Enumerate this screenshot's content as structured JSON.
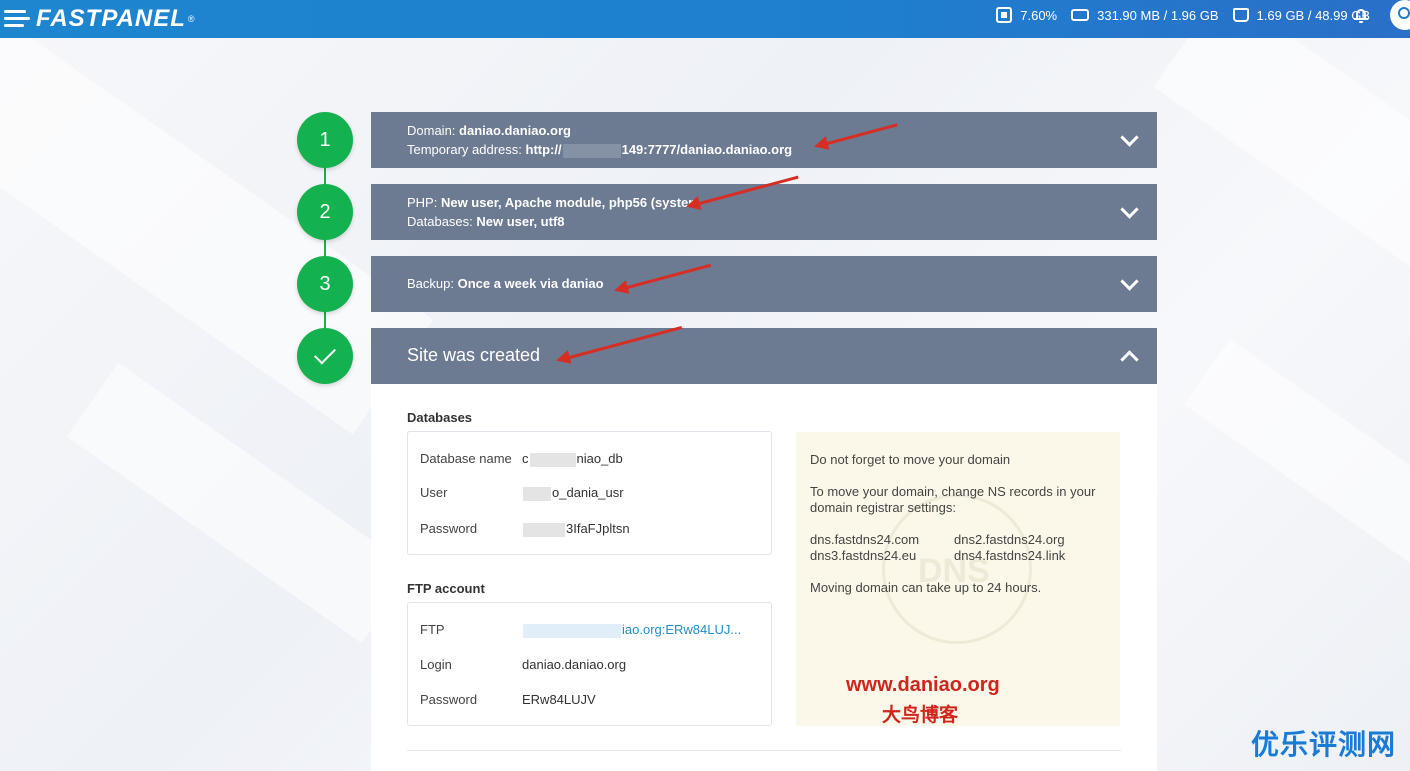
{
  "header": {
    "logo_text": "FASTPANEL",
    "logo_mark": "®",
    "cpu": "7.60%",
    "memory": "331.90 MB / 1.96 GB",
    "disk": "1.69 GB / 48.99 GB"
  },
  "steps": [
    {
      "number": "1",
      "line1_label": "Domain: ",
      "line1_value": "daniao.daniao.org",
      "line2_label": "Temporary address: ",
      "line2_value_a": "http://",
      "line2_value_b": "149:7777/daniao.daniao.org"
    },
    {
      "number": "2",
      "line1_label": "PHP: ",
      "line1_value": "New user, Apache module, php56 (system",
      "line2_label": "Databases: ",
      "line2_value": "New user, utf8"
    },
    {
      "number": "3",
      "line1_label": "Backup: ",
      "line1_value": "Once a week via daniao"
    },
    {
      "title": "Site was created"
    }
  ],
  "databases": {
    "title": "Databases",
    "name_label": "Database name",
    "name_value_a": "c",
    "name_value_b": "niao_db",
    "user_label": "User",
    "user_value": "o_dania_usr",
    "password_label": "Password",
    "password_value": "3IfaFJpltsn"
  },
  "ftp": {
    "title": "FTP account",
    "ftp_label": "FTP",
    "ftp_value": "iao.org:ERw84LUJ...",
    "login_label": "Login",
    "login_value": "daniao.daniao.org",
    "password_label": "Password",
    "password_value": "ERw84LUJV"
  },
  "hint": {
    "line1": "Do not forget to move your domain",
    "line2": "To move your domain, change NS records in your",
    "line3": "domain registrar settings:",
    "ns": [
      "dns.fastdns24.com",
      "dns2.fastdns24.org",
      "dns3.fastdns24.eu",
      "dns4.fastdns24.link"
    ],
    "line4": "Moving domain can take up to 24 hours.",
    "watermark": "DNS"
  },
  "overlay": {
    "site": "www.daniao.org",
    "site_cn": "大鸟博客",
    "corner": "优乐评测网"
  },
  "colors": {
    "header": "#1f7fcf",
    "step_green": "#14b24f",
    "panel": "#6c7a92",
    "link": "#1f8ec9",
    "annotation": "#d62e23"
  }
}
